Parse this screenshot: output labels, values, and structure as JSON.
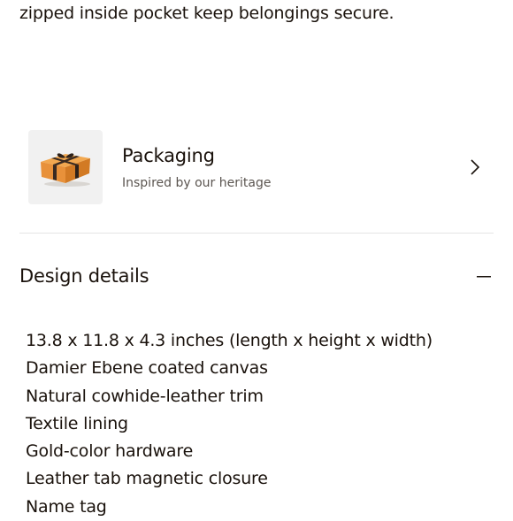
{
  "description": {
    "trailing_text": "zipped inside pocket keep belongings secure."
  },
  "packaging": {
    "title": "Packaging",
    "subtitle": "Inspired by our heritage",
    "thumbnail_icon": "gift-box-icon",
    "chevron_icon": "chevron-right-icon"
  },
  "design_details": {
    "title": "Design details",
    "expanded": true,
    "toggle_icon": "minus-icon",
    "items": [
      "13.8 x 11.8 x 4.3 inches (length x height x width)",
      "Damier Ebene coated canvas",
      "Natural cowhide-leather trim",
      "Textile lining",
      "Gold-color hardware",
      "Leather tab magnetic closure",
      "Name tag"
    ]
  },
  "colors": {
    "text": "#19110b",
    "muted_text": "#5b5550",
    "box_orange": "#e8913a",
    "divider": "#e4e4e4"
  }
}
